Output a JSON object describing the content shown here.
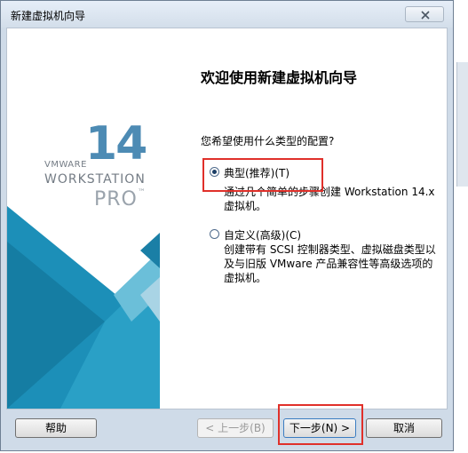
{
  "window": {
    "title": "新建虚拟机向导"
  },
  "banner": {
    "version": "14",
    "vendor": "VMWARE",
    "product": "WORKSTATION",
    "edition": "PRO",
    "trademark": "™"
  },
  "main": {
    "heading": "欢迎使用新建虚拟机向导",
    "question": "您希望使用什么类型的配置?",
    "options": [
      {
        "label": "典型(推荐)(T)",
        "description": "通过几个简单的步骤创建 Workstation 14.x 虚拟机。",
        "selected": true
      },
      {
        "label": "自定义(高级)(C)",
        "description": "创建带有 SCSI 控制器类型、虚拟磁盘类型以及与旧版 VMware 产品兼容性等高级选项的虚拟机。",
        "selected": false
      }
    ]
  },
  "buttons": {
    "help": "帮助",
    "back": "< 上一步(B)",
    "next": "下一步(N) >",
    "cancel": "取消"
  },
  "colors": {
    "brand_blue": "#4d8bb4",
    "highlight_red": "#e0302a"
  }
}
